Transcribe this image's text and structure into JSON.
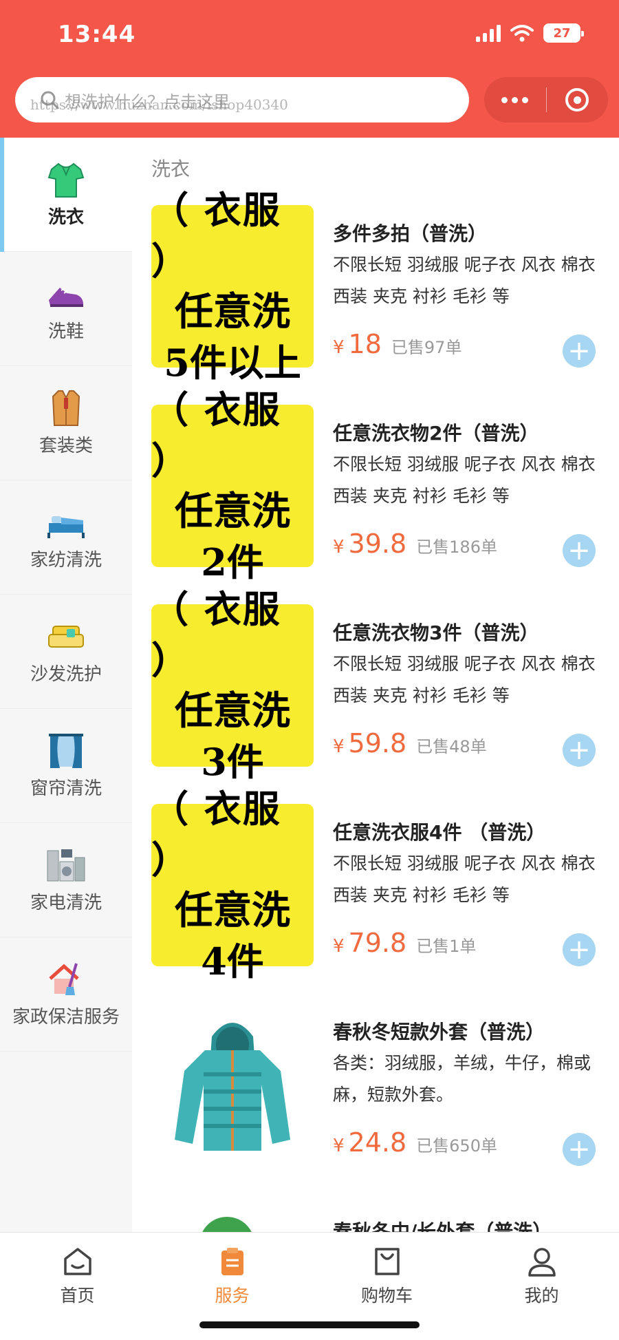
{
  "status": {
    "time": "13:44",
    "battery": "27"
  },
  "search": {
    "placeholder": "想洗护什么？点击这里",
    "watermark": "https://www.huzhan.com/ishop40340"
  },
  "sidebar": {
    "items": [
      {
        "label": "洗衣"
      },
      {
        "label": "洗鞋"
      },
      {
        "label": "套装类"
      },
      {
        "label": "家纺清洗"
      },
      {
        "label": "沙发洗护"
      },
      {
        "label": "窗帘清洗"
      },
      {
        "label": "家电清洗"
      },
      {
        "label": "家政保洁服务"
      }
    ]
  },
  "main": {
    "category_title": "洗衣",
    "products": [
      {
        "img": [
          "（ 衣服 ）",
          "任意洗",
          "5件以上"
        ],
        "name": "多件多拍（普洗）",
        "desc": "不限长短 羽绒服 呢子衣 风衣 棉衣 西装 夹克 衬衫 毛衫 等",
        "yen": "¥",
        "price": "18",
        "sold": "已售97单"
      },
      {
        "img": [
          "（ 衣服 ）",
          "任意洗",
          "2件"
        ],
        "name": "任意洗衣物2件（普洗）",
        "desc": "不限长短 羽绒服 呢子衣 风衣 棉衣 西装 夹克 衬衫 毛衫 等",
        "yen": "¥",
        "price": "39.8",
        "sold": "已售186单"
      },
      {
        "img": [
          "（ 衣服 ）",
          "任意洗",
          "3件"
        ],
        "name": "任意洗衣物3件（普洗）",
        "desc": "不限长短 羽绒服 呢子衣 风衣 棉衣 西装 夹克 衬衫 毛衫 等",
        "yen": "¥",
        "price": "59.8",
        "sold": "已售48单"
      },
      {
        "img": [
          "（ 衣服 ）",
          "任意洗",
          "4件"
        ],
        "name": "任意洗衣服4件 （普洗）",
        "desc": "不限长短 羽绒服 呢子衣 风衣 棉衣 西装 夹克 衬衫 毛衫 等",
        "yen": "¥",
        "price": "79.8",
        "sold": "已售1单"
      },
      {
        "name": "春秋冬短款外套（普洗）",
        "desc": "各类：羽绒服，羊绒，牛仔，棉或麻，短款外套。",
        "yen": "¥",
        "price": "24.8",
        "sold": "已售650单"
      },
      {
        "name": "春秋冬中/长外套（普洗）"
      }
    ]
  },
  "tabbar": {
    "items": [
      {
        "label": "首页"
      },
      {
        "label": "服务"
      },
      {
        "label": "购物车"
      },
      {
        "label": "我的"
      }
    ]
  },
  "colors": {
    "header": "#f4574a",
    "accent": "#f08a3a",
    "price": "#f06a3d",
    "add_button": "#a7d6f2"
  }
}
